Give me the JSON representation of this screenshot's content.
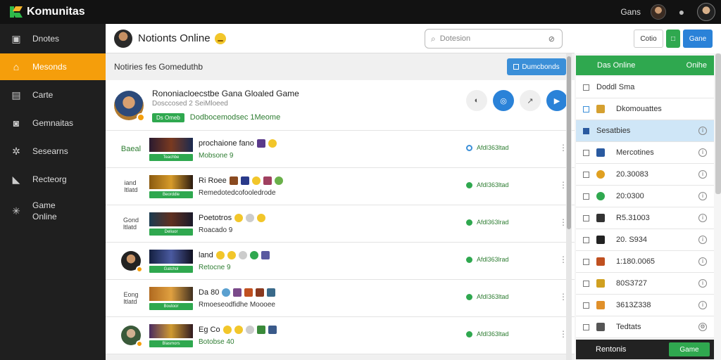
{
  "app": {
    "name": "Komunitas"
  },
  "topbar": {
    "user_name": "Gans"
  },
  "sidebar": {
    "items": [
      {
        "label": "Dnotes",
        "icon": "image-icon"
      },
      {
        "label": "Mesonds",
        "icon": "home-icon"
      },
      {
        "label": "Carte",
        "icon": "card-icon"
      },
      {
        "label": "Gemnaitas",
        "icon": "video-icon"
      },
      {
        "label": "Sesearns",
        "icon": "gear-icon"
      },
      {
        "label": "Recteorg",
        "icon": "thumb-icon"
      },
      {
        "label": "Game\nOnline",
        "icon": "sparkle-icon"
      }
    ]
  },
  "header": {
    "title": "Notionts Online",
    "search_placeholder": "Dotesion",
    "buttons": {
      "outline": "Cotio",
      "blue": "Gane"
    }
  },
  "subbar": {
    "label": "Notiries fes Gomeduthb",
    "button": "Dumcbonds"
  },
  "feature": {
    "title": "Rononiacloecstbe Gana Gloaled Game",
    "subtitle": "Dosccosed 2 SeiMloeed",
    "tag": "Ds Omeb",
    "tag_text": "Dodbocemodsec 1Meome"
  },
  "rows": [
    {
      "left": "Baeal",
      "tag": "Teachbe",
      "title": "prochaione fano",
      "sub": "Mobsone 9",
      "status": "AfdI363ltad",
      "thumb": "t1",
      "status_style": "hollow"
    },
    {
      "left": "iand\nltlatd",
      "tag": "Beorddle",
      "title": "Ri Roee",
      "sub": "Remedotedcofooledrode",
      "status": "AfdI363ltad",
      "thumb": "t2",
      "status_style": "solid"
    },
    {
      "left": "Gond\nltlatd",
      "tag": "Deliuor",
      "title": "Poetotros",
      "sub": "Roacado 9",
      "status": "Afdl363lrad",
      "thumb": "t3",
      "status_style": "solid"
    },
    {
      "left": "",
      "tag": "Gatchol",
      "title": "land",
      "sub": "Retocne 9",
      "status": "Afdl363lrad",
      "thumb": "t4",
      "status_style": "solid"
    },
    {
      "left": "Eong\nltlatd",
      "tag": "Boutoor",
      "title": "Da 80",
      "sub": "Rmoeseodfidhe Moooee",
      "status": "AfdI363ltad",
      "thumb": "t5",
      "status_style": "solid"
    },
    {
      "left": "",
      "tag": "Blasmors",
      "title": "Eg Co",
      "sub": "Botobse 40",
      "status": "AfdI363ltad",
      "thumb": "t6",
      "status_style": "solid"
    }
  ],
  "right_panel": {
    "header": "Das Online",
    "header_right": "Onihe",
    "items": [
      {
        "label": "Doddl Sma",
        "active": false,
        "mini": "#999"
      },
      {
        "label": "Dkomouattes",
        "active": false,
        "mini": "#d5a030"
      },
      {
        "label": "Sesatbies",
        "active": true,
        "mini": "#2a5aa0"
      },
      {
        "label": "Mercotines",
        "active": false,
        "mini": "#2a5aa0"
      },
      {
        "label": "20.30083",
        "active": false,
        "mini": "#e0a020"
      },
      {
        "label": "20:0300",
        "active": false,
        "mini": "#2fa84f"
      },
      {
        "label": "R5.31003",
        "active": false,
        "mini": "#333"
      },
      {
        "label": "20. S934",
        "active": false,
        "mini": "#222"
      },
      {
        "label": "1:180.0065",
        "active": false,
        "mini": "#c05020"
      },
      {
        "label": "80S3727",
        "active": false,
        "mini": "#d0a020"
      },
      {
        "label": "3613Z338",
        "active": false,
        "mini": "#e0902a"
      },
      {
        "label": "Tedtats",
        "active": false,
        "mini": "#555"
      }
    ],
    "footer": "Rentonis",
    "footer_button": "Game"
  }
}
